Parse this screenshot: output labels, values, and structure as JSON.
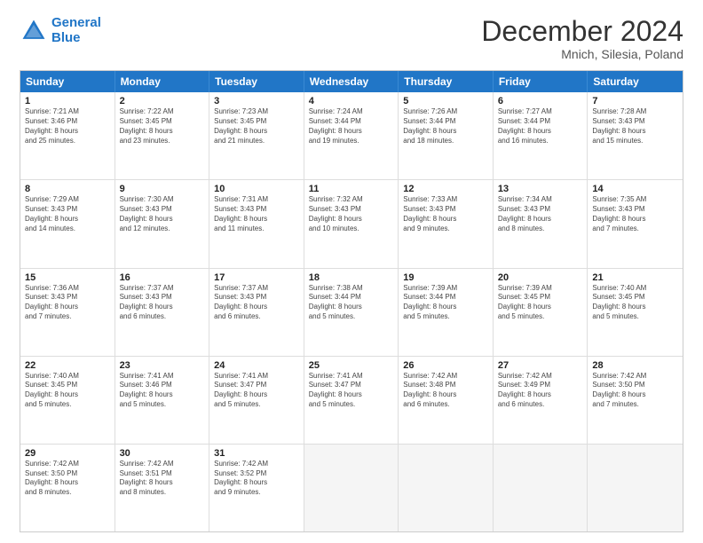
{
  "logo": {
    "line1": "General",
    "line2": "Blue"
  },
  "header": {
    "month": "December 2024",
    "location": "Mnich, Silesia, Poland"
  },
  "weekdays": [
    "Sunday",
    "Monday",
    "Tuesday",
    "Wednesday",
    "Thursday",
    "Friday",
    "Saturday"
  ],
  "weeks": [
    [
      {
        "day": "1",
        "info": "Sunrise: 7:21 AM\nSunset: 3:46 PM\nDaylight: 8 hours\nand 25 minutes."
      },
      {
        "day": "2",
        "info": "Sunrise: 7:22 AM\nSunset: 3:45 PM\nDaylight: 8 hours\nand 23 minutes."
      },
      {
        "day": "3",
        "info": "Sunrise: 7:23 AM\nSunset: 3:45 PM\nDaylight: 8 hours\nand 21 minutes."
      },
      {
        "day": "4",
        "info": "Sunrise: 7:24 AM\nSunset: 3:44 PM\nDaylight: 8 hours\nand 19 minutes."
      },
      {
        "day": "5",
        "info": "Sunrise: 7:26 AM\nSunset: 3:44 PM\nDaylight: 8 hours\nand 18 minutes."
      },
      {
        "day": "6",
        "info": "Sunrise: 7:27 AM\nSunset: 3:44 PM\nDaylight: 8 hours\nand 16 minutes."
      },
      {
        "day": "7",
        "info": "Sunrise: 7:28 AM\nSunset: 3:43 PM\nDaylight: 8 hours\nand 15 minutes."
      }
    ],
    [
      {
        "day": "8",
        "info": "Sunrise: 7:29 AM\nSunset: 3:43 PM\nDaylight: 8 hours\nand 14 minutes."
      },
      {
        "day": "9",
        "info": "Sunrise: 7:30 AM\nSunset: 3:43 PM\nDaylight: 8 hours\nand 12 minutes."
      },
      {
        "day": "10",
        "info": "Sunrise: 7:31 AM\nSunset: 3:43 PM\nDaylight: 8 hours\nand 11 minutes."
      },
      {
        "day": "11",
        "info": "Sunrise: 7:32 AM\nSunset: 3:43 PM\nDaylight: 8 hours\nand 10 minutes."
      },
      {
        "day": "12",
        "info": "Sunrise: 7:33 AM\nSunset: 3:43 PM\nDaylight: 8 hours\nand 9 minutes."
      },
      {
        "day": "13",
        "info": "Sunrise: 7:34 AM\nSunset: 3:43 PM\nDaylight: 8 hours\nand 8 minutes."
      },
      {
        "day": "14",
        "info": "Sunrise: 7:35 AM\nSunset: 3:43 PM\nDaylight: 8 hours\nand 7 minutes."
      }
    ],
    [
      {
        "day": "15",
        "info": "Sunrise: 7:36 AM\nSunset: 3:43 PM\nDaylight: 8 hours\nand 7 minutes."
      },
      {
        "day": "16",
        "info": "Sunrise: 7:37 AM\nSunset: 3:43 PM\nDaylight: 8 hours\nand 6 minutes."
      },
      {
        "day": "17",
        "info": "Sunrise: 7:37 AM\nSunset: 3:43 PM\nDaylight: 8 hours\nand 6 minutes."
      },
      {
        "day": "18",
        "info": "Sunrise: 7:38 AM\nSunset: 3:44 PM\nDaylight: 8 hours\nand 5 minutes."
      },
      {
        "day": "19",
        "info": "Sunrise: 7:39 AM\nSunset: 3:44 PM\nDaylight: 8 hours\nand 5 minutes."
      },
      {
        "day": "20",
        "info": "Sunrise: 7:39 AM\nSunset: 3:45 PM\nDaylight: 8 hours\nand 5 minutes."
      },
      {
        "day": "21",
        "info": "Sunrise: 7:40 AM\nSunset: 3:45 PM\nDaylight: 8 hours\nand 5 minutes."
      }
    ],
    [
      {
        "day": "22",
        "info": "Sunrise: 7:40 AM\nSunset: 3:45 PM\nDaylight: 8 hours\nand 5 minutes."
      },
      {
        "day": "23",
        "info": "Sunrise: 7:41 AM\nSunset: 3:46 PM\nDaylight: 8 hours\nand 5 minutes."
      },
      {
        "day": "24",
        "info": "Sunrise: 7:41 AM\nSunset: 3:47 PM\nDaylight: 8 hours\nand 5 minutes."
      },
      {
        "day": "25",
        "info": "Sunrise: 7:41 AM\nSunset: 3:47 PM\nDaylight: 8 hours\nand 5 minutes."
      },
      {
        "day": "26",
        "info": "Sunrise: 7:42 AM\nSunset: 3:48 PM\nDaylight: 8 hours\nand 6 minutes."
      },
      {
        "day": "27",
        "info": "Sunrise: 7:42 AM\nSunset: 3:49 PM\nDaylight: 8 hours\nand 6 minutes."
      },
      {
        "day": "28",
        "info": "Sunrise: 7:42 AM\nSunset: 3:50 PM\nDaylight: 8 hours\nand 7 minutes."
      }
    ],
    [
      {
        "day": "29",
        "info": "Sunrise: 7:42 AM\nSunset: 3:50 PM\nDaylight: 8 hours\nand 8 minutes."
      },
      {
        "day": "30",
        "info": "Sunrise: 7:42 AM\nSunset: 3:51 PM\nDaylight: 8 hours\nand 8 minutes."
      },
      {
        "day": "31",
        "info": "Sunrise: 7:42 AM\nSunset: 3:52 PM\nDaylight: 8 hours\nand 9 minutes."
      },
      {
        "day": "",
        "info": ""
      },
      {
        "day": "",
        "info": ""
      },
      {
        "day": "",
        "info": ""
      },
      {
        "day": "",
        "info": ""
      }
    ]
  ]
}
